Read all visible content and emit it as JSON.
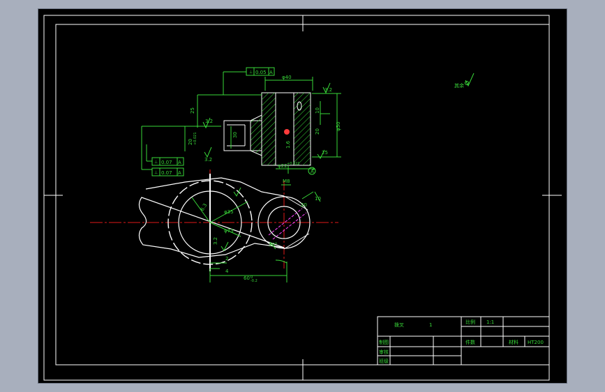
{
  "colors": {
    "frame": "#ffffff",
    "dimension": "#39d839",
    "centerline": "#e01818",
    "outline": "#ffffff",
    "hatch": "#39d839",
    "hidden": "#ff44ff"
  },
  "section_view": {
    "tolerance_top": "0.05",
    "tolerance_top_datum": "A",
    "tolerance_left_1": "0.07",
    "tolerance_left_1_datum": "A",
    "tolerance_left_2": "0.07",
    "tolerance_left_2_datum": "A",
    "dim_top_width": "φ40",
    "dim_height_25": "25",
    "dim_height_20": "20",
    "dim_30": "30",
    "dim_10": "10",
    "dim_20_right": "20",
    "dim_50": "φ50",
    "dim_bore": "20",
    "dim_bore_tol": "+0.021",
    "dim_bore_tol_low": "0",
    "dim_hole": "φ22",
    "dim_hole_tol": "+0.021",
    "dim_hole_tol_low": "0",
    "surface_32_a": "3.2",
    "surface_32_b": "3.2",
    "surface_32_c": "3.2",
    "surface_16": "1.6",
    "surface_25": "25",
    "datum_label": "A"
  },
  "front_view": {
    "dim_m8": "M8",
    "dim_20": "20",
    "dim_phi35": "φ35",
    "dim_phi35_tol": "+0.5",
    "dim_phi73": "φ73",
    "dim_phi73_tol": "+0.5",
    "dim_2": "2",
    "dim_4": "4",
    "dim_60": "60",
    "dim_60_tol": "0",
    "dim_60_tol_low": "-0.2",
    "dim_r": "R8",
    "dim_10": "10",
    "surface_32": "3.2",
    "surface_63": "6.3",
    "dim_30deg": "30°"
  },
  "roughness_note": {
    "label": "其余"
  },
  "title_block": {
    "r1c1": "拨叉",
    "r1c2": "1",
    "r1c3": "比例",
    "r1c4": "1:1",
    "r2c3": "件数",
    "r2c4": "材料",
    "r2c5": "HT200",
    "r2_label": "制图",
    "r3_label": "审核",
    "r4_label": "班级"
  }
}
